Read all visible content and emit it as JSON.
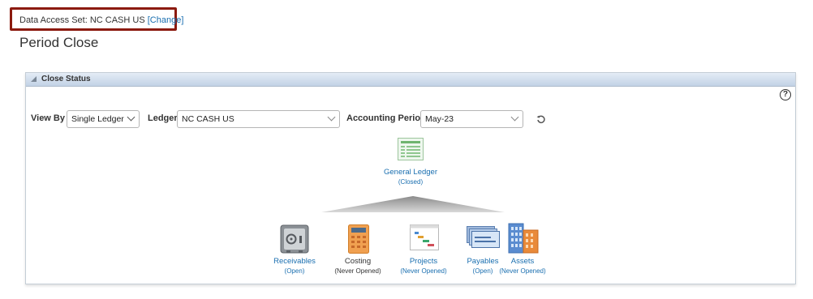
{
  "header": {
    "data_access_label": "Data Access Set:",
    "data_access_value": "NC CASH US",
    "change_link": "[Change]",
    "page_title": "Period Close"
  },
  "panel": {
    "title": "Close Status",
    "help_symbol": "?"
  },
  "filters": {
    "view_by_label": "View By",
    "view_by_value": "Single Ledger",
    "ledger_label": "Ledger",
    "ledger_value": "NC CASH US",
    "period_label": "Accounting Period",
    "period_value": "May-23"
  },
  "ledger_node": {
    "name": "General Ledger",
    "status": "(Closed)"
  },
  "subledgers": [
    {
      "name": "Receivables",
      "status": "(Open)",
      "icon": "safe-icon"
    },
    {
      "name": "Costing",
      "status": "(Never Opened)",
      "icon": "calculator-icon"
    },
    {
      "name": "Projects",
      "status": "(Never Opened)",
      "icon": "gantt-chart-icon"
    },
    {
      "name": "Payables",
      "status": "(Open)",
      "icon": "checks-icon"
    },
    {
      "name": "Assets",
      "status": "(Never Opened)",
      "icon": "buildings-icon"
    }
  ],
  "colors": {
    "highlight_border": "#8b1a0e",
    "link": "#1a6fb0",
    "header_gradient_top": "#e4ecf6",
    "header_gradient_bottom": "#c2d2e6"
  }
}
